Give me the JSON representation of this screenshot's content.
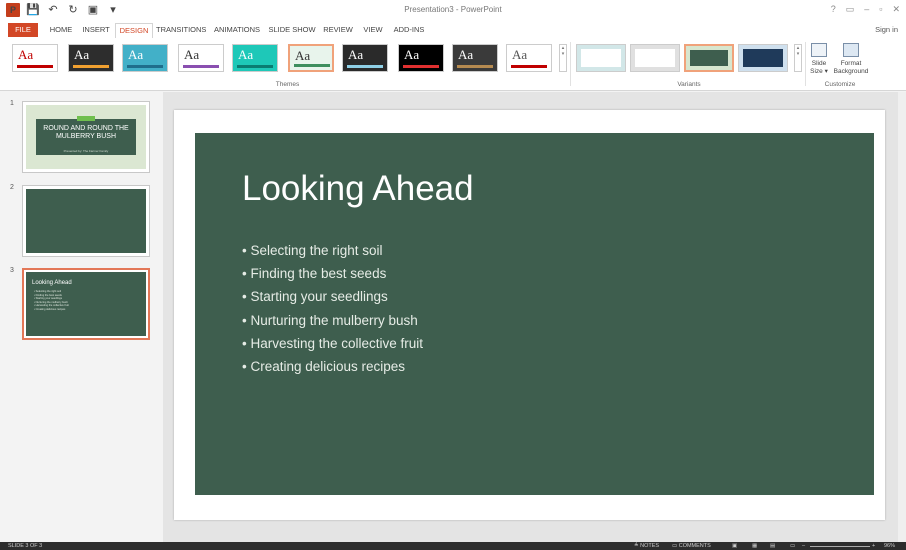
{
  "window": {
    "title": "Presentation3 - PowerPoint",
    "controls": [
      "?",
      "▭",
      "–",
      "▫",
      "✕"
    ]
  },
  "qat": {
    "logo": "P",
    "save": "💾",
    "undo": "↶",
    "redo": "↻",
    "present": "▣",
    "more": "▾"
  },
  "ribbon_tabs": {
    "file": "FILE",
    "home": "HOME",
    "insert": "INSERT",
    "design": "DESIGN",
    "transitions": "TRANSITIONS",
    "animations": "ANIMATIONS",
    "slide_show": "SLIDE SHOW",
    "review": "REVIEW",
    "view": "VIEW",
    "add_ins": "ADD-INS",
    "sign_in": "Sign in"
  },
  "ribbon": {
    "themes_label": "Themes",
    "variants_label": "Variants",
    "customize_label": "Customize",
    "themes": [
      {
        "text": "Aa",
        "bg": "#ffffff",
        "fg": "#c00000",
        "bar": "#c00000"
      },
      {
        "text": "Aa",
        "bg": "#2d2d2d",
        "fg": "#ffffff",
        "bar": "#f0a030"
      },
      {
        "text": "Aa",
        "bg": "#42b0c8",
        "fg": "#ffffff",
        "bar": "#1f6e8c"
      },
      {
        "text": "Aa",
        "bg": "#ffffff",
        "fg": "#333333",
        "bar": "#8a4fb0"
      },
      {
        "text": "Aa",
        "bg": "#1ec8b8",
        "fg": "#ffffff",
        "bar": "#0a7c72"
      },
      {
        "text": "Aa",
        "bg": "#e8f4ec",
        "fg": "#333333",
        "bar": "#3e8e5e"
      },
      {
        "text": "Aa",
        "bg": "#2a2a2a",
        "fg": "#ffffff",
        "bar": "#8fd0e6"
      },
      {
        "text": "Aa",
        "bg": "#000000",
        "fg": "#ffffff",
        "bar": "#e03030"
      },
      {
        "text": "Aa",
        "bg": "#3a3a3a",
        "fg": "#ffffff",
        "bar": "#b58a50"
      },
      {
        "text": "Aa",
        "bg": "#ffffff",
        "fg": "#555555",
        "bar": "#c00000"
      }
    ],
    "variants": [
      {
        "frame": "#d2e7e8",
        "inner": "#ffffff"
      },
      {
        "frame": "#e0e0e0",
        "inner": "#ffffff"
      },
      {
        "frame": "#d7e6cf",
        "inner": "#3e5e4e"
      },
      {
        "frame": "#cfe0ee",
        "inner": "#1f3a5a"
      }
    ],
    "slide_size_label": "Slide\nSize ▾",
    "format_bg_label": "Format\nBackground"
  },
  "thumbnails": [
    {
      "num": "1",
      "title": "ROUND AND ROUND THE MULBERRY BUSH",
      "subtitle": "Presented by: The Farmer Family"
    },
    {
      "num": "2"
    },
    {
      "num": "3",
      "title": "Looking Ahead"
    }
  ],
  "slide": {
    "title": "Looking Ahead",
    "bullets": [
      "Selecting the right soil",
      "Finding the best seeds",
      "Starting your seedlings",
      "Nurturing the mulberry bush",
      "Harvesting the collective fruit",
      "Creating delicious recipes"
    ]
  },
  "status": {
    "slide_of": "SLIDE 3 OF 3",
    "notes": "≜ NOTES",
    "comments": "▭ COMMENTS",
    "zoom": "96%"
  },
  "colors": {
    "accent": "#d24726",
    "slide_green": "#3e5e4e"
  }
}
